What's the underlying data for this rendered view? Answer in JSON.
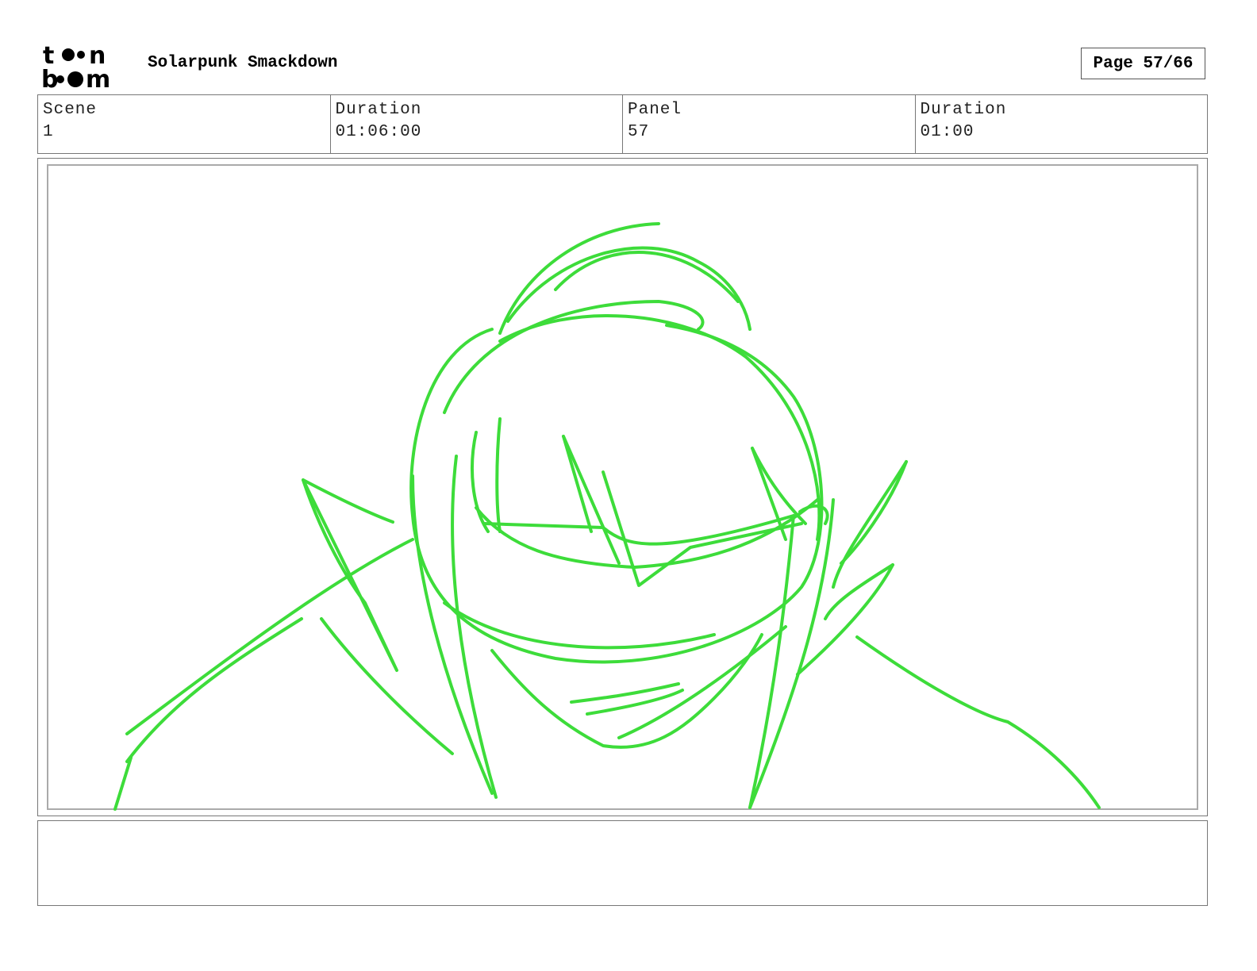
{
  "header": {
    "logo_text": "toon boom",
    "project_title": "Solarpunk Smackdown",
    "page_label": "Page 57/66"
  },
  "info": [
    {
      "label": "Scene",
      "value": "1"
    },
    {
      "label": "Duration",
      "value": "01:06:00"
    },
    {
      "label": "Panel",
      "value": "57"
    },
    {
      "label": "Duration",
      "value": "01:00"
    }
  ],
  "sketch": {
    "color": "#3ddc3a"
  },
  "notes": {
    "text": ""
  }
}
